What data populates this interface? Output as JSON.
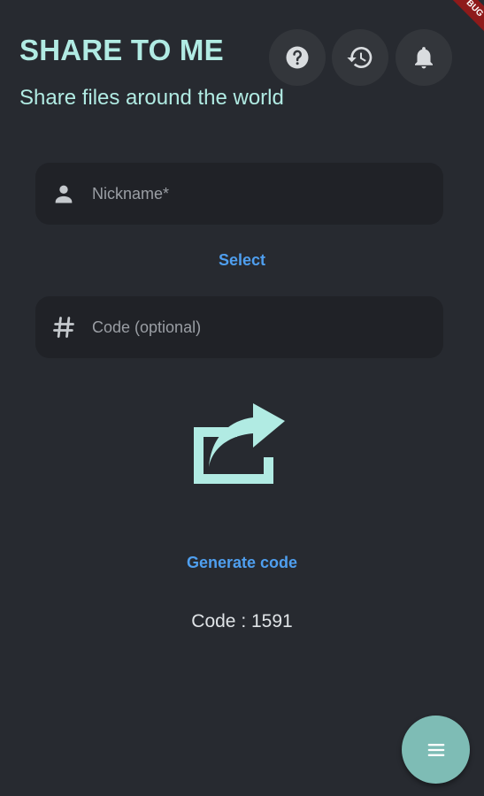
{
  "header": {
    "title": "SHARE TO ME",
    "subtitle": "Share files around the world",
    "actions": [
      {
        "name": "help",
        "icon": "help-icon"
      },
      {
        "name": "history",
        "icon": "history-icon"
      },
      {
        "name": "notifications",
        "icon": "bell-icon"
      }
    ]
  },
  "form": {
    "nickname": {
      "placeholder": "Nickname*",
      "value": "",
      "icon": "person-icon"
    },
    "select_label": "Select",
    "code": {
      "placeholder": "Code (optional)",
      "value": "",
      "icon": "hash-icon"
    }
  },
  "share": {
    "icon": "share-icon",
    "generate_label": "Generate code",
    "code_text": "Code : 1591"
  },
  "fab": {
    "icon": "menu-icon"
  },
  "badge": {
    "text": "BUG"
  },
  "colors": {
    "background": "#272a30",
    "accent": "#b1ebe3",
    "link": "#4f9fef",
    "fab": "#7ebcb5"
  }
}
